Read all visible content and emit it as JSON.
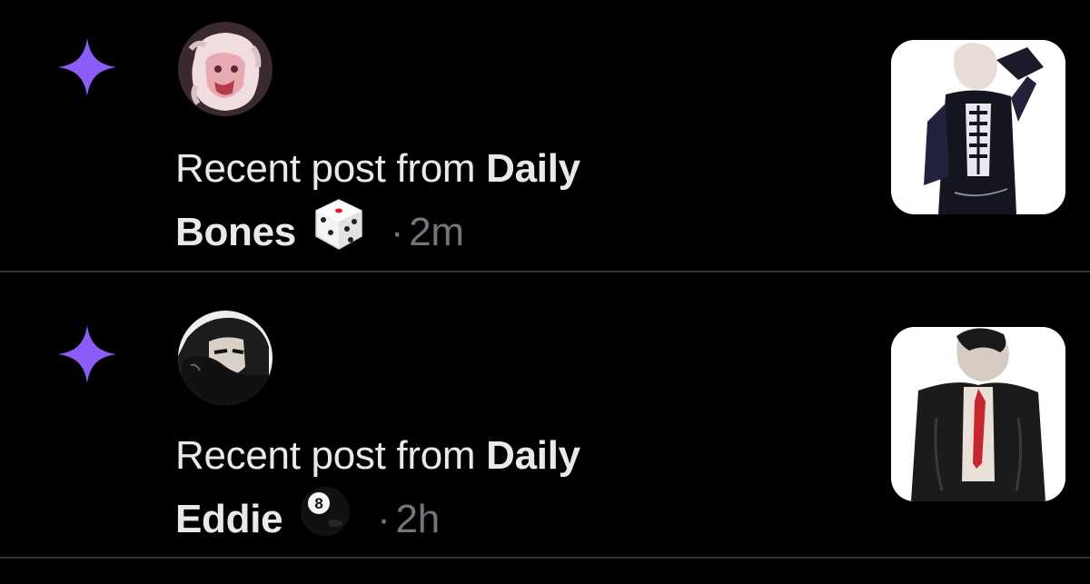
{
  "notifications": [
    {
      "icon": "sparkle-icon",
      "avatar": "daily-bones-avatar",
      "text_prefix": "Recent post from ",
      "account_name": "Daily Bones",
      "account_first": "Daily",
      "account_second": "Bones",
      "emoji": "game-die",
      "separator": "·",
      "time": "2m",
      "thumbnail": "bones-post-image"
    },
    {
      "icon": "sparkle-icon",
      "avatar": "daily-eddie-avatar",
      "text_prefix": "Recent post from ",
      "account_name": "Daily Eddie",
      "account_first": "Daily",
      "account_second": "Eddie",
      "emoji": "pool-8-ball",
      "separator": "·",
      "time": "2h",
      "thumbnail": "eddie-post-image"
    }
  ],
  "colors": {
    "background": "#000000",
    "sparkle": "#8b5cf6",
    "text": "#e7e9ea",
    "muted": "#71767b",
    "divider": "#2f3336"
  }
}
